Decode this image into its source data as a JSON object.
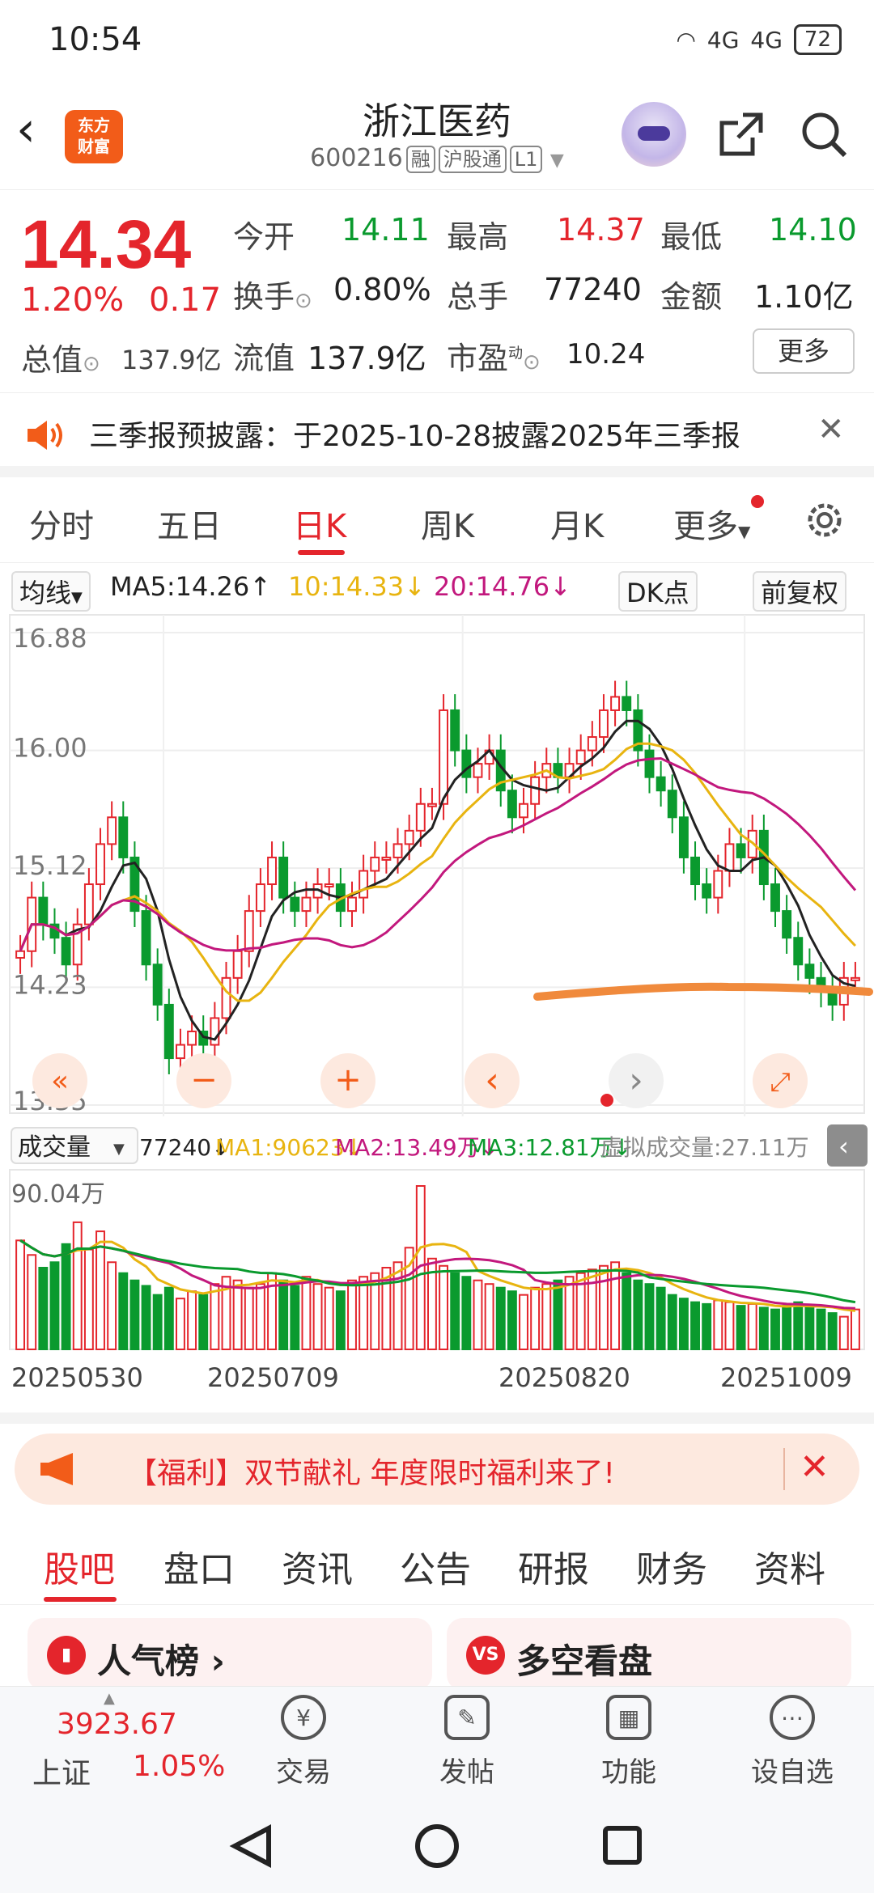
{
  "status_bar": {
    "time": "10:54",
    "signal1": "4G",
    "signal2": "4G",
    "battery": "72"
  },
  "header": {
    "back": "‹",
    "logo_line1": "东方",
    "logo_line2": "财富",
    "stock_name": "浙江医药",
    "stock_code": "600216",
    "tags": [
      "融",
      "沪股通",
      "L1"
    ]
  },
  "quote": {
    "price": "14.34",
    "change_pct": "1.20%",
    "change": "0.17",
    "total_value_label": "总值",
    "total_value": "137.9亿",
    "open_label": "今开",
    "open": "14.11",
    "high_label": "最高",
    "high": "14.37",
    "low_label": "最低",
    "low": "14.10",
    "turnover_label": "换手",
    "turnover": "0.80%",
    "volume_label": "总手",
    "volume": "77240",
    "amount_label": "金额",
    "amount": "1.10亿",
    "float_label": "流值",
    "float_value": "137.9亿",
    "pe_label": "市盈",
    "pe_sup": "动",
    "pe": "10.24",
    "more_button": "更多"
  },
  "notice": {
    "text": "三季报预披露：于2025-10-28披露2025年三季报",
    "close": "✕"
  },
  "period_tabs": [
    "分时",
    "五日",
    "日K",
    "周K",
    "月K",
    "更多"
  ],
  "active_period": "日K",
  "ma_row": {
    "selector": "均线",
    "ma5": "MA5:14.26↑",
    "ma10": "10:14.33↓",
    "ma20": "20:14.76↓",
    "dk_button": "DK点",
    "fq_button": "前复权",
    "colors": {
      "ma5": "#222222",
      "ma10": "#e8b410",
      "ma20": "#c2187d"
    }
  },
  "chart_controls": {
    "left": "«",
    "minus": "−",
    "plus": "+",
    "prev": "‹",
    "next": "›",
    "expand": "⤢"
  },
  "vol_row": {
    "selector": "成交量",
    "vol": "77240↓",
    "ma1": "MA1:90623↓",
    "ma2": "MA2:13.49万↓",
    "ma3": "MA3:12.81万↓",
    "virtual": "虚拟成交量:27.11万",
    "max_label": "90.04万"
  },
  "chart_data": [
    {
      "type": "candlestick",
      "y_ticks": [
        "16.88",
        "16.00",
        "15.12",
        "14.23",
        "13.35"
      ],
      "ylim": [
        13.35,
        16.88
      ],
      "x_labels": [
        "20250530",
        "20250709",
        "20250820",
        "20251009"
      ],
      "series": [
        {
          "name": "MA5",
          "color": "#222222"
        },
        {
          "name": "MA10",
          "color": "#e8b410"
        },
        {
          "name": "MA20",
          "color": "#c2187d"
        }
      ],
      "closes": [
        14.5,
        14.9,
        14.7,
        14.6,
        14.4,
        14.7,
        15.0,
        15.3,
        15.5,
        15.2,
        14.8,
        14.4,
        14.1,
        13.7,
        13.8,
        13.9,
        13.8,
        14.0,
        14.3,
        14.5,
        14.8,
        15.0,
        15.2,
        14.9,
        14.8,
        14.9,
        15.0,
        15.0,
        14.8,
        14.9,
        15.1,
        15.2,
        15.2,
        15.3,
        15.4,
        15.6,
        15.6,
        16.3,
        16.0,
        15.8,
        15.9,
        16.0,
        15.7,
        15.5,
        15.6,
        15.8,
        15.9,
        15.8,
        15.9,
        16.0,
        16.1,
        16.3,
        16.4,
        16.3,
        16.0,
        15.8,
        15.7,
        15.5,
        15.2,
        15.0,
        14.9,
        15.1,
        15.3,
        15.2,
        15.4,
        15.0,
        14.8,
        14.6,
        14.4,
        14.3,
        14.2,
        14.1,
        14.3,
        14.3
      ]
    },
    {
      "type": "bar",
      "ymax_label": "90.04万",
      "values": [
        60,
        52,
        45,
        48,
        58,
        70,
        55,
        65,
        48,
        42,
        38,
        35,
        30,
        34,
        28,
        32,
        30,
        36,
        40,
        38,
        34,
        36,
        42,
        38,
        35,
        40,
        36,
        34,
        32,
        38,
        40,
        42,
        45,
        48,
        56,
        90,
        50,
        46,
        42,
        40,
        38,
        36,
        34,
        32,
        30,
        34,
        36,
        38,
        40,
        42,
        44,
        46,
        48,
        42,
        38,
        36,
        34,
        30,
        28,
        26,
        25,
        27,
        26,
        24,
        25,
        23,
        22,
        24,
        26,
        24,
        22,
        20,
        18,
        22
      ]
    }
  ],
  "promo": {
    "text": "【福利】双节献礼 年度限时福利来了!",
    "close": "✕"
  },
  "section_tabs": [
    "股吧",
    "盘口",
    "资讯",
    "公告",
    "研报",
    "财务",
    "资料"
  ],
  "active_section": "股吧",
  "cards": [
    {
      "icon": "▮",
      "label": "人气榜 ›"
    },
    {
      "icon": "VS",
      "label": "多空看盘"
    }
  ],
  "bottom_nav": {
    "index_value": "3923.67",
    "index_name": "上证",
    "index_pct": "1.05%",
    "items": [
      {
        "icon": "¥",
        "label": "交易"
      },
      {
        "icon": "✎",
        "label": "发帖"
      },
      {
        "icon": "▦",
        "label": "功能"
      },
      {
        "icon": "⋯",
        "label": "设自选"
      }
    ]
  }
}
